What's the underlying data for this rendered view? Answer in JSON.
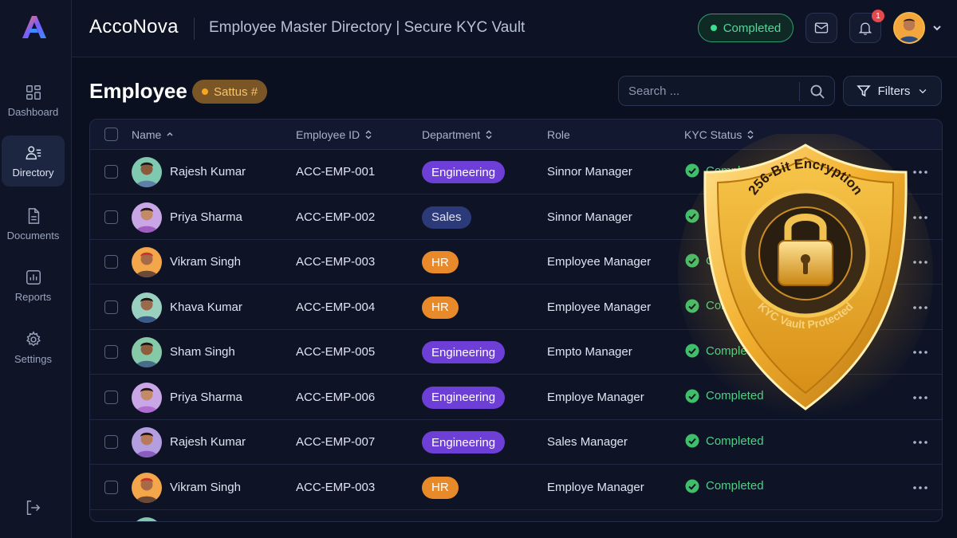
{
  "app": {
    "brand": "AccoNova",
    "title": "Employee Master Directory | Secure KYC Vault",
    "status": "Completed",
    "notification_count": "1"
  },
  "sidebar": {
    "items": [
      {
        "label": "Dashboard",
        "icon": "dashboard-icon",
        "active": false
      },
      {
        "label": "Directory",
        "icon": "directory-icon",
        "active": true
      },
      {
        "label": "Documents",
        "icon": "documents-icon",
        "active": false
      },
      {
        "label": "Reports",
        "icon": "reports-icon",
        "active": false
      },
      {
        "label": "Settings",
        "icon": "settings-icon",
        "active": false
      }
    ]
  },
  "page": {
    "title": "Employee",
    "badge": "Sattus #",
    "search_placeholder": "Search ...",
    "filters_label": "Filters"
  },
  "table": {
    "headers": [
      "Name",
      "Employee ID",
      "Department",
      "Role",
      "KYC Status"
    ],
    "rows": [
      {
        "name": "Rajesh Kumar",
        "id": "ACC-EMP-001",
        "dept": "Engineering",
        "role": "Sinnor Manager",
        "kyc": "Completed"
      },
      {
        "name": "Priya Sharma",
        "id": "ACC-EMP-002",
        "dept": "Sales",
        "role": "Sinnor Manager",
        "kyc": "Completed"
      },
      {
        "name": "Vikram Singh",
        "id": "ACC-EMP-003",
        "dept": "HR",
        "role": "Employee Manager",
        "kyc": "Completed"
      },
      {
        "name": "Khava Kumar",
        "id": "ACC-EMP-004",
        "dept": "HR",
        "role": "Employee Manager",
        "kyc": "Completed"
      },
      {
        "name": "Sham Singh",
        "id": "ACC-EMP-005",
        "dept": "Engineering",
        "role": "Empto Manager",
        "kyc": "Completed"
      },
      {
        "name": "Priya Sharma",
        "id": "ACC-EMP-006",
        "dept": "Engineering",
        "role": "Employe Manager",
        "kyc": "Completed"
      },
      {
        "name": "Rajesh Kumar",
        "id": "ACC-EMP-007",
        "dept": "Engineering",
        "role": "Sales Manager",
        "kyc": "Completed"
      },
      {
        "name": "Vikram Singh",
        "id": "ACC-EMP-003",
        "dept": "HR",
        "role": "Employe Manager",
        "kyc": "Completed"
      }
    ]
  },
  "shield": {
    "top_text": "256-Bit Encryption",
    "bottom_text": "KYC Vault Protected"
  },
  "colors": {
    "engineering": "#6d3fd6",
    "sales": "#2c3a7a",
    "hr": "#e8892a",
    "success": "#3fbf6a",
    "gold": "#f2b234"
  }
}
